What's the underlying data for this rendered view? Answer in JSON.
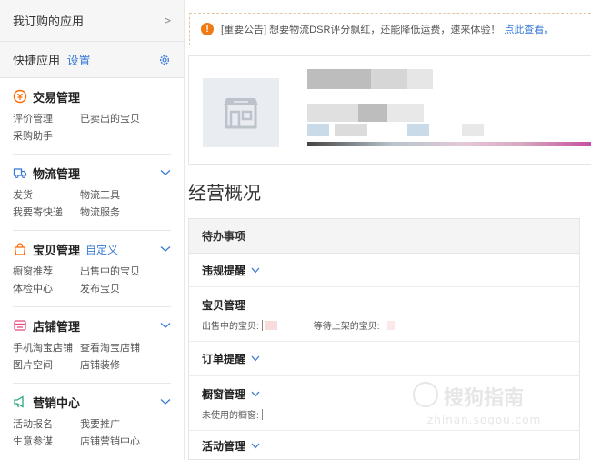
{
  "sidebar": {
    "subscribed": {
      "label": "我订购的应用",
      "chevron": ">"
    },
    "quick": {
      "label": "快捷应用",
      "settings": "设置"
    },
    "sections": [
      {
        "title": "交易管理",
        "links": [
          "评价管理",
          "已卖出的宝贝",
          "采购助手"
        ]
      },
      {
        "title": "物流管理",
        "links": [
          "发货",
          "物流工具",
          "我要寄快递",
          "物流服务"
        ]
      },
      {
        "title": "宝贝管理",
        "custom": "自定义",
        "links": [
          "橱窗推荐",
          "出售中的宝贝",
          "体检中心",
          "发布宝贝"
        ]
      },
      {
        "title": "店铺管理",
        "links": [
          "手机淘宝店铺",
          "查看淘宝店铺",
          "图片空间",
          "店铺装修"
        ]
      },
      {
        "title": "营销中心",
        "links": [
          "活动报名",
          "我要推广",
          "生意参谋",
          "店铺营销中心"
        ]
      }
    ]
  },
  "notice": {
    "icon": "!",
    "text": "[重要公告] 想要物流DSR评分飘红，还能降低运费，速来体验！",
    "link": "点此查看。"
  },
  "overview": {
    "title": "经营概况"
  },
  "todo": {
    "header": "待办事项",
    "rows": [
      {
        "title": "违规提醒"
      },
      {
        "title": "宝贝管理",
        "items": [
          "出售中的宝贝:",
          "等待上架的宝贝:"
        ]
      },
      {
        "title": "订单提醒"
      },
      {
        "title": "橱窗管理",
        "items": [
          "未使用的橱窗:"
        ]
      },
      {
        "title": "活动管理"
      }
    ]
  },
  "watermark": {
    "text": "搜狗指南",
    "sub": "zhinan.sogou.com"
  },
  "colors": {
    "accent": "#3a7bd5",
    "notice_icon": "#f07a13",
    "brand_orange": "#ff6a00"
  }
}
